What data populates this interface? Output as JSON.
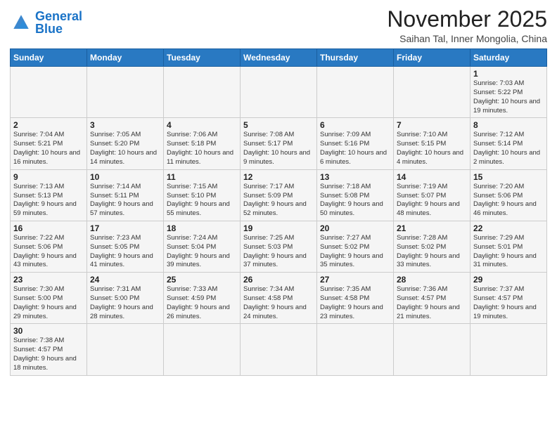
{
  "header": {
    "logo_general": "General",
    "logo_blue": "Blue",
    "month": "November 2025",
    "location": "Saihan Tal, Inner Mongolia, China"
  },
  "weekdays": [
    "Sunday",
    "Monday",
    "Tuesday",
    "Wednesday",
    "Thursday",
    "Friday",
    "Saturday"
  ],
  "weeks": [
    [
      {
        "day": "",
        "info": ""
      },
      {
        "day": "",
        "info": ""
      },
      {
        "day": "",
        "info": ""
      },
      {
        "day": "",
        "info": ""
      },
      {
        "day": "",
        "info": ""
      },
      {
        "day": "",
        "info": ""
      },
      {
        "day": "1",
        "info": "Sunrise: 7:03 AM\nSunset: 5:22 PM\nDaylight: 10 hours\nand 19 minutes."
      }
    ],
    [
      {
        "day": "2",
        "info": "Sunrise: 7:04 AM\nSunset: 5:21 PM\nDaylight: 10 hours\nand 16 minutes."
      },
      {
        "day": "3",
        "info": "Sunrise: 7:05 AM\nSunset: 5:20 PM\nDaylight: 10 hours\nand 14 minutes."
      },
      {
        "day": "4",
        "info": "Sunrise: 7:06 AM\nSunset: 5:18 PM\nDaylight: 10 hours\nand 11 minutes."
      },
      {
        "day": "5",
        "info": "Sunrise: 7:08 AM\nSunset: 5:17 PM\nDaylight: 10 hours\nand 9 minutes."
      },
      {
        "day": "6",
        "info": "Sunrise: 7:09 AM\nSunset: 5:16 PM\nDaylight: 10 hours\nand 6 minutes."
      },
      {
        "day": "7",
        "info": "Sunrise: 7:10 AM\nSunset: 5:15 PM\nDaylight: 10 hours\nand 4 minutes."
      },
      {
        "day": "8",
        "info": "Sunrise: 7:12 AM\nSunset: 5:14 PM\nDaylight: 10 hours\nand 2 minutes."
      }
    ],
    [
      {
        "day": "9",
        "info": "Sunrise: 7:13 AM\nSunset: 5:13 PM\nDaylight: 9 hours\nand 59 minutes."
      },
      {
        "day": "10",
        "info": "Sunrise: 7:14 AM\nSunset: 5:11 PM\nDaylight: 9 hours\nand 57 minutes."
      },
      {
        "day": "11",
        "info": "Sunrise: 7:15 AM\nSunset: 5:10 PM\nDaylight: 9 hours\nand 55 minutes."
      },
      {
        "day": "12",
        "info": "Sunrise: 7:17 AM\nSunset: 5:09 PM\nDaylight: 9 hours\nand 52 minutes."
      },
      {
        "day": "13",
        "info": "Sunrise: 7:18 AM\nSunset: 5:08 PM\nDaylight: 9 hours\nand 50 minutes."
      },
      {
        "day": "14",
        "info": "Sunrise: 7:19 AM\nSunset: 5:07 PM\nDaylight: 9 hours\nand 48 minutes."
      },
      {
        "day": "15",
        "info": "Sunrise: 7:20 AM\nSunset: 5:06 PM\nDaylight: 9 hours\nand 46 minutes."
      }
    ],
    [
      {
        "day": "16",
        "info": "Sunrise: 7:22 AM\nSunset: 5:06 PM\nDaylight: 9 hours\nand 43 minutes."
      },
      {
        "day": "17",
        "info": "Sunrise: 7:23 AM\nSunset: 5:05 PM\nDaylight: 9 hours\nand 41 minutes."
      },
      {
        "day": "18",
        "info": "Sunrise: 7:24 AM\nSunset: 5:04 PM\nDaylight: 9 hours\nand 39 minutes."
      },
      {
        "day": "19",
        "info": "Sunrise: 7:25 AM\nSunset: 5:03 PM\nDaylight: 9 hours\nand 37 minutes."
      },
      {
        "day": "20",
        "info": "Sunrise: 7:27 AM\nSunset: 5:02 PM\nDaylight: 9 hours\nand 35 minutes."
      },
      {
        "day": "21",
        "info": "Sunrise: 7:28 AM\nSunset: 5:02 PM\nDaylight: 9 hours\nand 33 minutes."
      },
      {
        "day": "22",
        "info": "Sunrise: 7:29 AM\nSunset: 5:01 PM\nDaylight: 9 hours\nand 31 minutes."
      }
    ],
    [
      {
        "day": "23",
        "info": "Sunrise: 7:30 AM\nSunset: 5:00 PM\nDaylight: 9 hours\nand 29 minutes."
      },
      {
        "day": "24",
        "info": "Sunrise: 7:31 AM\nSunset: 5:00 PM\nDaylight: 9 hours\nand 28 minutes."
      },
      {
        "day": "25",
        "info": "Sunrise: 7:33 AM\nSunset: 4:59 PM\nDaylight: 9 hours\nand 26 minutes."
      },
      {
        "day": "26",
        "info": "Sunrise: 7:34 AM\nSunset: 4:58 PM\nDaylight: 9 hours\nand 24 minutes."
      },
      {
        "day": "27",
        "info": "Sunrise: 7:35 AM\nSunset: 4:58 PM\nDaylight: 9 hours\nand 23 minutes."
      },
      {
        "day": "28",
        "info": "Sunrise: 7:36 AM\nSunset: 4:57 PM\nDaylight: 9 hours\nand 21 minutes."
      },
      {
        "day": "29",
        "info": "Sunrise: 7:37 AM\nSunset: 4:57 PM\nDaylight: 9 hours\nand 19 minutes."
      }
    ],
    [
      {
        "day": "30",
        "info": "Sunrise: 7:38 AM\nSunset: 4:57 PM\nDaylight: 9 hours\nand 18 minutes."
      },
      {
        "day": "",
        "info": ""
      },
      {
        "day": "",
        "info": ""
      },
      {
        "day": "",
        "info": ""
      },
      {
        "day": "",
        "info": ""
      },
      {
        "day": "",
        "info": ""
      },
      {
        "day": "",
        "info": ""
      }
    ]
  ]
}
